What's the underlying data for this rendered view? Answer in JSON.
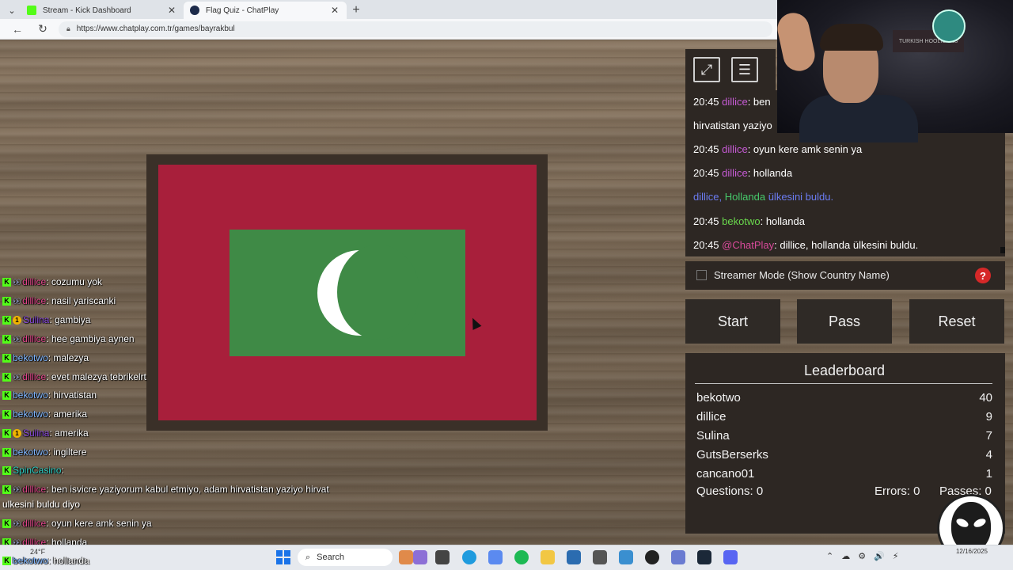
{
  "browser": {
    "tabs": [
      {
        "label": "Stream - Kick Dashboard",
        "active": false
      },
      {
        "label": "Flag Quiz - ChatPlay",
        "active": true
      }
    ],
    "url": "https://www.chatplay.com.tr/games/bayrakbul"
  },
  "panel": {
    "chat": [
      {
        "time": "20:45",
        "user": "dillice",
        "text": ": ben"
      },
      {
        "time": "",
        "user": "",
        "text": "hirvatistan yaziyo"
      },
      {
        "time": "20:45",
        "user": "dillice",
        "text": ": oyun kere amk senin ya"
      },
      {
        "time": "20:45",
        "user": "dillice",
        "text": ": hollanda"
      },
      {
        "time": "",
        "user": "dillice",
        "text": "ülkesini buldu.",
        "country": "Hollanda"
      },
      {
        "time": "20:45",
        "user": "bekotwo",
        "text": ": hollanda"
      },
      {
        "time": "20:45",
        "user": "@ChatPlay",
        "text": ": dillice, hollanda ülkesini buldu."
      }
    ],
    "streamer_mode_label": "Streamer Mode (Show Country Name)",
    "help_label": "?",
    "buttons": {
      "start": "Start",
      "pass": "Pass",
      "reset": "Reset"
    },
    "leaderboard": {
      "title": "Leaderboard",
      "rows": [
        {
          "name": "bekotwo",
          "score": "40"
        },
        {
          "name": "dillice",
          "score": "9"
        },
        {
          "name": "Sulina",
          "score": "7"
        },
        {
          "name": "GutsBerserks",
          "score": "4"
        },
        {
          "name": "cancano01",
          "score": "1"
        }
      ],
      "questions": "Questions: 0",
      "errors": "Errors: 0",
      "passes": "Passes: 0"
    }
  },
  "overlay_chat": [
    {
      "user": "dillice",
      "text": ": cozumu yok",
      "badges": "K"
    },
    {
      "user": "dillice",
      "text": ": nasil yariscanki",
      "badges": "K"
    },
    {
      "user": "Sulina",
      "text": ": gambiya",
      "badges": "KO"
    },
    {
      "user": "dillice",
      "text": ": hee gambiya aynen",
      "badges": "K"
    },
    {
      "user": "bekotwo",
      "text": ": malezya",
      "badges": "K"
    },
    {
      "user": "dillice",
      "text": ": evet malezya tebrikelrt",
      "badges": "K"
    },
    {
      "user": "bekotwo",
      "text": ": hirvatistan",
      "badges": "K"
    },
    {
      "user": "bekotwo",
      "text": ": amerika",
      "badges": "K"
    },
    {
      "user": "Sulina",
      "text": ": amerika",
      "badges": "KO"
    },
    {
      "user": "bekotwo",
      "text": ": ingiltere",
      "badges": "K"
    },
    {
      "user": "SpinCasino",
      "text": ":",
      "badges": "K"
    },
    {
      "user": "dillice",
      "text": ": ben isvicre yaziyorum kabul etmiyo, adam hirvatistan yaziyo hirvat",
      "badges": "K"
    },
    {
      "user": "dillice",
      "text": ": oyun kere amk senin ya",
      "badges": "K"
    },
    {
      "user": "dillice",
      "text": ": hollanda",
      "badges": "K"
    },
    {
      "user": "bekotwo",
      "text": ": hollanda",
      "badges": "K"
    }
  ],
  "overlay_wrap": "ulkesini buldu diyo",
  "webcam": {
    "sign_text": "TURKISH HOOLIGANS"
  },
  "taskbar": {
    "weather": "24°F",
    "search_label": "Search",
    "date": "12/16/2025"
  },
  "colors": {
    "flag_red": "#a81f3b",
    "flag_green": "#3f8a46",
    "panel_bg": "#2d2723",
    "kick_green": "#53fc18"
  }
}
